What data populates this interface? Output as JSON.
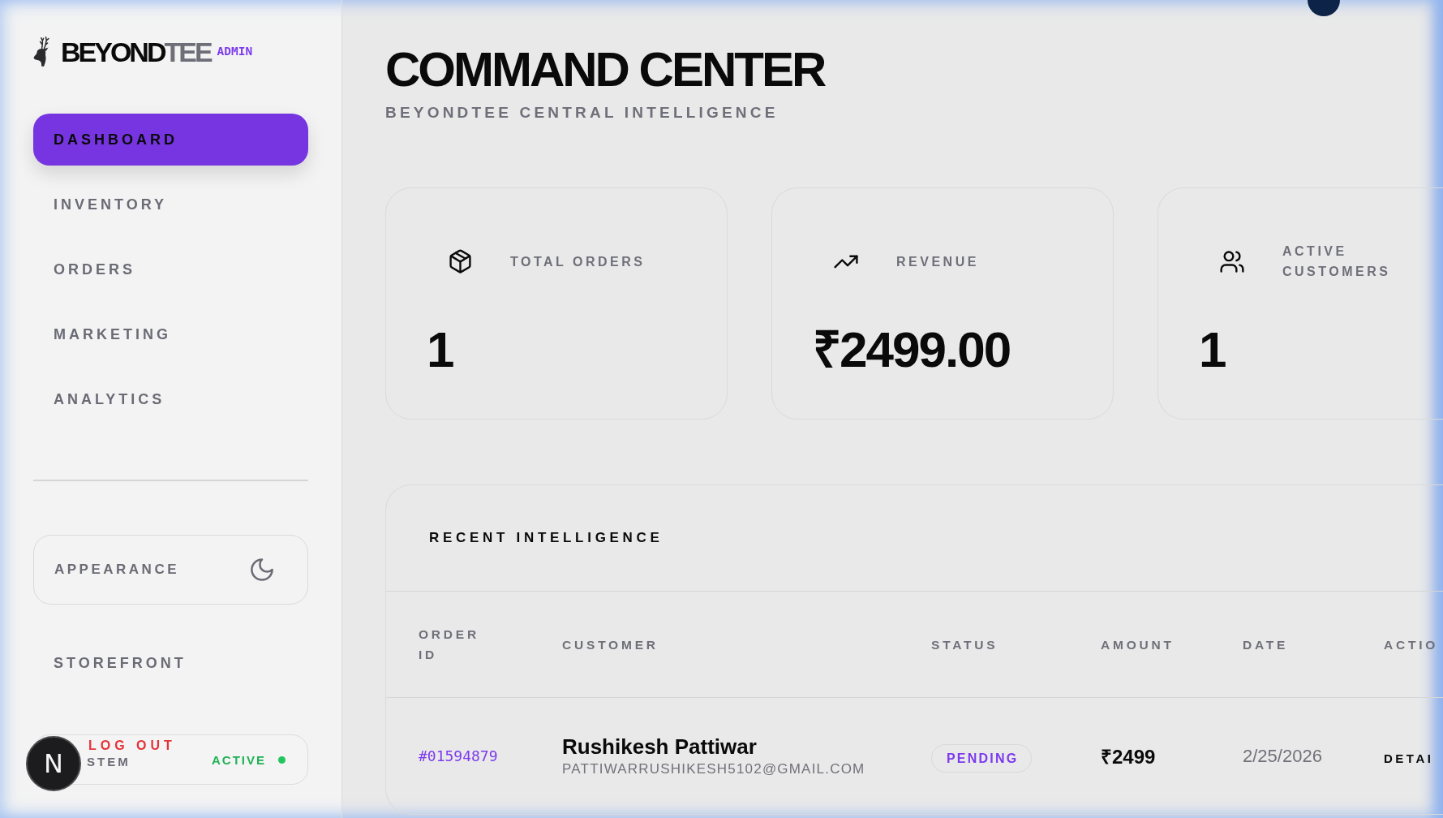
{
  "sidebar": {
    "brand": {
      "name": "BEYOND",
      "name_accent": "TEE",
      "badge": "ADMIN"
    },
    "nav": [
      {
        "label": "DASHBOARD",
        "selected": true
      },
      {
        "label": "INVENTORY",
        "selected": false
      },
      {
        "label": "ORDERS",
        "selected": false
      },
      {
        "label": "MARKETING",
        "selected": false
      },
      {
        "label": "ANALYTICS",
        "selected": false
      }
    ],
    "appearance": {
      "label": "APPEARANCE"
    },
    "links": [
      {
        "label": "STOREFRONT",
        "kind": "link"
      },
      {
        "label": "LOG OUT",
        "kind": "logout"
      }
    ],
    "system_status": {
      "label": "STEM",
      "value": "ACTIVE",
      "online": true
    }
  },
  "dev_button": {
    "label": "N"
  },
  "header": {
    "title": "COMMAND CENTER",
    "subtitle": "BEYONDTEE CENTRAL INTELLIGENCE"
  },
  "stats": [
    {
      "kind": "orders",
      "label": "TOTAL ORDERS",
      "value": "1"
    },
    {
      "kind": "revenue",
      "label": "REVENUE",
      "value": "₹2499.00"
    },
    {
      "kind": "customers",
      "label": "ACTIVE CUSTOMERS",
      "value": "1"
    }
  ],
  "recent_orders": {
    "title": "RECENT INTELLIGENCE",
    "columns": [
      "ORDER ID",
      "CUSTOMER",
      "STATUS",
      "AMOUNT",
      "DATE",
      "ACTIO"
    ],
    "rows": [
      {
        "order_id": "#01594879",
        "customer": "Rushikesh Pattiwar",
        "email": "PATTIWARRUSHIKESH5102@GMAIL.COM",
        "status": "PENDING",
        "amount": "₹2499",
        "date": "2/25/2026",
        "action": "DETAI"
      }
    ]
  }
}
